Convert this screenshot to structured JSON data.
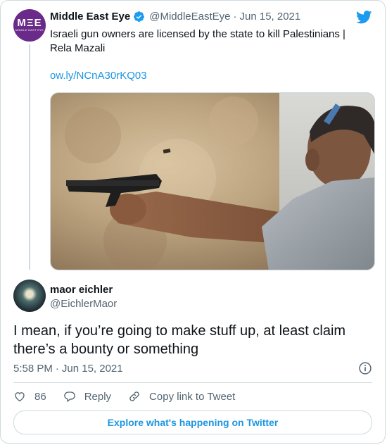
{
  "parent": {
    "author_name": "Middle East Eye",
    "handle": "@MiddleEastEye",
    "separator": "·",
    "date": "Jun 15, 2021",
    "text": "Israeli gun owners are licensed by the state to kill Palestinians | Rela Mazali",
    "link": "ow.ly/NCnA30rKQ03",
    "avatar_logo": "MΞE",
    "avatar_subtext": "MIDDLE EAST EYE",
    "photo_alt": "man firing a handgun at a shooting range"
  },
  "reply": {
    "author_name": "maor eichler",
    "handle": "@EichlerMaor",
    "text": "I mean, if you’re going to make stuff up, at least claim there’s a bounty or something",
    "time": "5:58 PM",
    "separator": "·",
    "date": "Jun 15, 2021"
  },
  "actions": {
    "like_count": "86",
    "reply_label": "Reply",
    "copy_label": "Copy link to Tweet"
  },
  "footer": {
    "explore_label": "Explore what's happening on Twitter"
  },
  "colors": {
    "link": "#1b95e0",
    "muted": "#536471",
    "border": "#cfd9de",
    "mee_purple": "#6a2a8a",
    "verified": "#1d9bf0"
  },
  "icons": [
    "verified-badge-icon",
    "twitter-bird-icon",
    "info-icon",
    "heart-icon",
    "reply-icon",
    "link-icon"
  ]
}
